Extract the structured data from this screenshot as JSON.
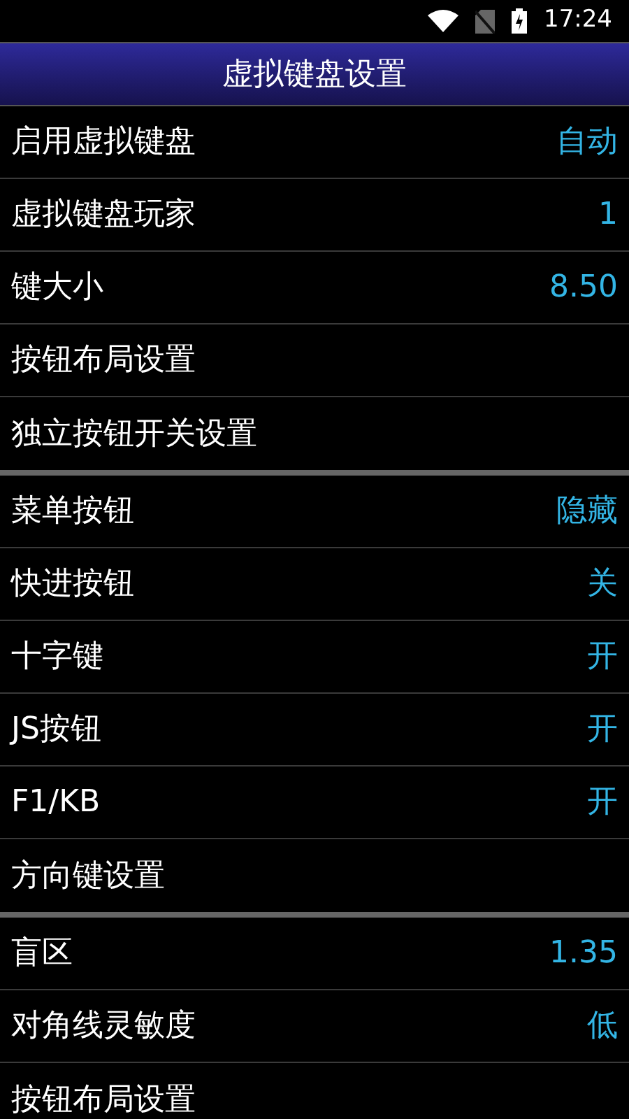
{
  "status_bar": {
    "time": "17:24"
  },
  "title": "虚拟键盘设置",
  "sections": [
    {
      "rows": [
        {
          "label": "启用虚拟键盘",
          "value": "自动"
        },
        {
          "label": "虚拟键盘玩家",
          "value": "1"
        },
        {
          "label": "键大小",
          "value": "8.50"
        },
        {
          "label": "按钮布局设置"
        },
        {
          "label": "独立按钮开关设置"
        }
      ]
    },
    {
      "rows": [
        {
          "label": "菜单按钮",
          "value": "隐藏"
        },
        {
          "label": "快进按钮",
          "value": "关"
        },
        {
          "label": "十字键",
          "value": "开"
        },
        {
          "label": "JS按钮",
          "value": "开"
        },
        {
          "label": "F1/KB",
          "value": "开"
        },
        {
          "label": "方向键设置"
        }
      ]
    },
    {
      "rows": [
        {
          "label": "盲区",
          "value": "1.35"
        },
        {
          "label": "对角线灵敏度",
          "value": "低"
        },
        {
          "label": "按钮布局设置"
        }
      ]
    }
  ]
}
